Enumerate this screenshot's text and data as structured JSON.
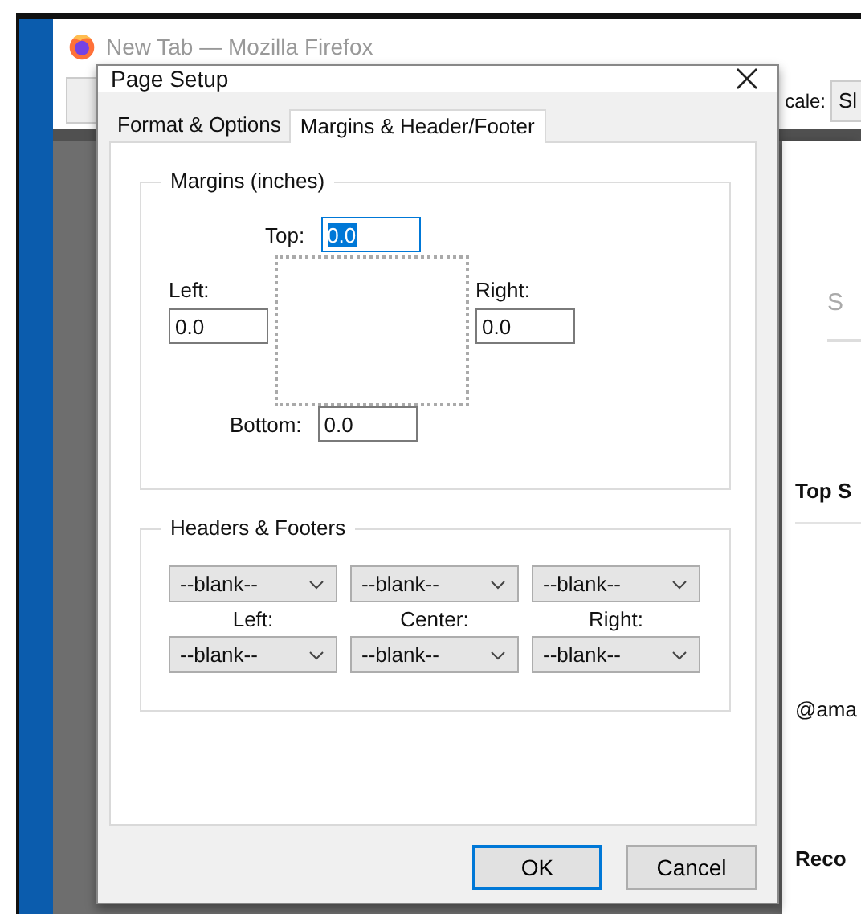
{
  "background_window": {
    "title": "New Tab — Mozilla Firefox",
    "scale_label": "cale:",
    "scale_value": "Sl",
    "page_items": [
      {
        "kind": "faint",
        "text": "S"
      },
      {
        "kind": "heading",
        "text": "Top S"
      },
      {
        "kind": "text",
        "text": "@ama"
      },
      {
        "kind": "heading",
        "text": "Reco"
      }
    ]
  },
  "dialog": {
    "title": "Page Setup",
    "tabs": [
      {
        "label": "Format & Options",
        "selected": false
      },
      {
        "label": "Margins & Header/Footer",
        "selected": true
      }
    ],
    "margins": {
      "legend": "Margins (inches)",
      "top": {
        "label": "Top:",
        "value": "0.0",
        "selected": true
      },
      "left": {
        "label": "Left:",
        "value": "0.0",
        "selected": false
      },
      "right": {
        "label": "Right:",
        "value": "0.0",
        "selected": false
      },
      "bottom": {
        "label": "Bottom:",
        "value": "0.0",
        "selected": false
      }
    },
    "headers_footers": {
      "legend": "Headers & Footers",
      "headers": [
        "--blank--",
        "--blank--",
        "--blank--"
      ],
      "labels": [
        "Left:",
        "Center:",
        "Right:"
      ],
      "footers": [
        "--blank--",
        "--blank--",
        "--blank--"
      ]
    },
    "buttons": [
      {
        "label": "OK",
        "default": true
      },
      {
        "label": "Cancel",
        "default": false
      }
    ]
  }
}
